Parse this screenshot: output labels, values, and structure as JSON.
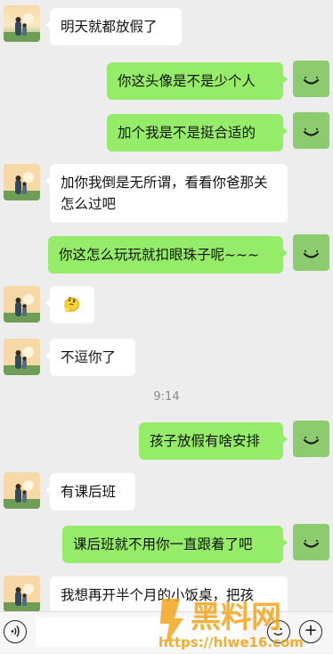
{
  "colors": {
    "background": "#ededed",
    "incoming_bubble": "#ffffff",
    "outgoing_bubble": "#95ec69",
    "watermark": "#f3a51c"
  },
  "messages": [
    {
      "side": "in",
      "text": "明天就都放假了"
    },
    {
      "side": "out",
      "text": "你这头像是不是少个人"
    },
    {
      "side": "out",
      "text": "加个我是不是挺合适的"
    },
    {
      "side": "in",
      "text": "加你我倒是无所谓，看看你爸那关怎么过吧"
    },
    {
      "side": "out",
      "text": "你这怎么玩玩就扣眼珠子呢~~~"
    },
    {
      "side": "in",
      "text": "🤔"
    },
    {
      "side": "in",
      "text": "不逗你了"
    },
    {
      "side": "out",
      "text": "孩子放假有啥安排"
    },
    {
      "side": "in",
      "text": "有课后班"
    },
    {
      "side": "out",
      "text": "课后班就不用你一直跟着了吧"
    },
    {
      "side": "in",
      "text": "我想再开半个月的小饭桌，把孩"
    }
  ],
  "timestamp": "9:14",
  "input_bar": {
    "voice_icon": "voice-icon",
    "emoji_icon": "emoji-icon",
    "more_icon": "plus-icon",
    "more_label": "+"
  },
  "watermark": {
    "brand": "黑料网",
    "url": "https://hlwe16.com"
  }
}
